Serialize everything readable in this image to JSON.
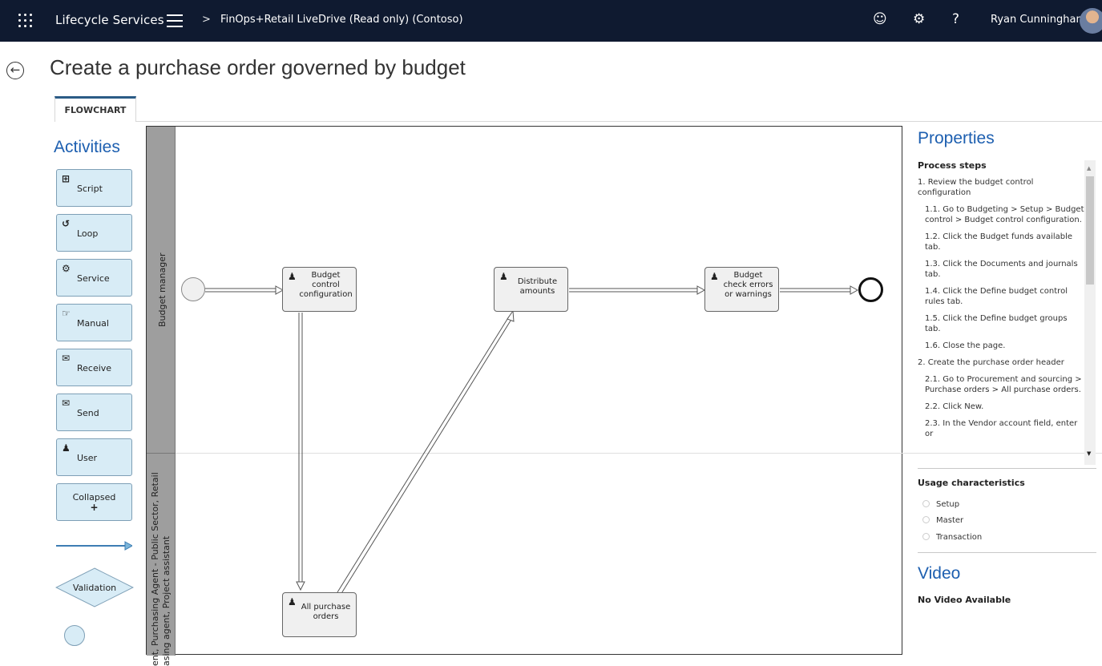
{
  "topbar": {
    "app_title": "Lifecycle Services",
    "breadcrumb_separator": ">",
    "breadcrumb": "FinOps+Retail LiveDrive (Read only) (Contoso)",
    "help_symbol": "?",
    "user_name": "Ryan Cunningham",
    "icons": [
      "waffle-icon",
      "hamburger-icon",
      "smiley-icon",
      "gear-icon",
      "help-icon",
      "avatar"
    ]
  },
  "page": {
    "back_symbol": "←",
    "title": "Create a purchase order governed by budget"
  },
  "tabs": [
    {
      "label": "FLOWCHART",
      "active": true
    }
  ],
  "activities": {
    "title": "Activities",
    "items": [
      {
        "label": "Script",
        "icon": "script-icon",
        "glyph": "⊞"
      },
      {
        "label": "Loop",
        "icon": "loop-icon",
        "glyph": "↺"
      },
      {
        "label": "Service",
        "icon": "gear-icon",
        "glyph": "⚙"
      },
      {
        "label": "Manual",
        "icon": "pointing-hand-icon",
        "glyph": "☞"
      },
      {
        "label": "Receive",
        "icon": "envelope-open-icon",
        "glyph": "✉"
      },
      {
        "label": "Send",
        "icon": "envelope-filled-icon",
        "glyph": "✉"
      },
      {
        "label": "User",
        "icon": "user-icon",
        "glyph": "♟"
      }
    ],
    "collapsed_label": "Collapsed",
    "collapsed_symbol": "+",
    "validation_label": "Validation"
  },
  "flowchart": {
    "lanes": [
      {
        "label": "Budget manager"
      },
      {
        "label": "ent, Purchasing Agent - Public Sector, Retail",
        "label_2": "asing agent, Project assistant"
      }
    ],
    "nodes": [
      {
        "id": "n1",
        "label": "Budget control configuration"
      },
      {
        "id": "n2",
        "label": "Distribute amounts"
      },
      {
        "id": "n3",
        "label": "Budget check errors or warnings"
      },
      {
        "id": "n4",
        "label": "All purchase orders"
      }
    ],
    "user_glyph": "♟"
  },
  "properties": {
    "title": "Properties",
    "process_steps_title": "Process steps",
    "steps": [
      {
        "text": "1. Review the budget control configuration",
        "sub": false
      },
      {
        "text": "1.1. Go to Budgeting > Setup > Budget control > Budget control configuration.",
        "sub": true
      },
      {
        "text": "1.2. Click the Budget funds available tab.",
        "sub": true
      },
      {
        "text": "1.3. Click the Documents and journals tab.",
        "sub": true
      },
      {
        "text": "1.4. Click the Define budget control rules tab.",
        "sub": true
      },
      {
        "text": "1.5. Click the Define budget groups tab.",
        "sub": true
      },
      {
        "text": "1.6. Close the page.",
        "sub": true
      },
      {
        "text": "2. Create the purchase order header",
        "sub": false
      },
      {
        "text": "2.1. Go to Procurement and sourcing > Purchase orders > All purchase orders.",
        "sub": true
      },
      {
        "text": "2.2. Click New.",
        "sub": true
      },
      {
        "text": "2.3. In the Vendor account field, enter or",
        "sub": true
      }
    ],
    "scroll_up": "▲",
    "scroll_down": "▼",
    "usage_title": "Usage characteristics",
    "usage_options": [
      "Setup",
      "Master",
      "Transaction"
    ],
    "video_title": "Video",
    "video_status": "No Video Available"
  },
  "colors": {
    "topbar": "#0f1a30",
    "accent_blue": "#1d5fb0",
    "activity_fill": "#d8ecf6",
    "lane_header": "#9e9e9e"
  }
}
